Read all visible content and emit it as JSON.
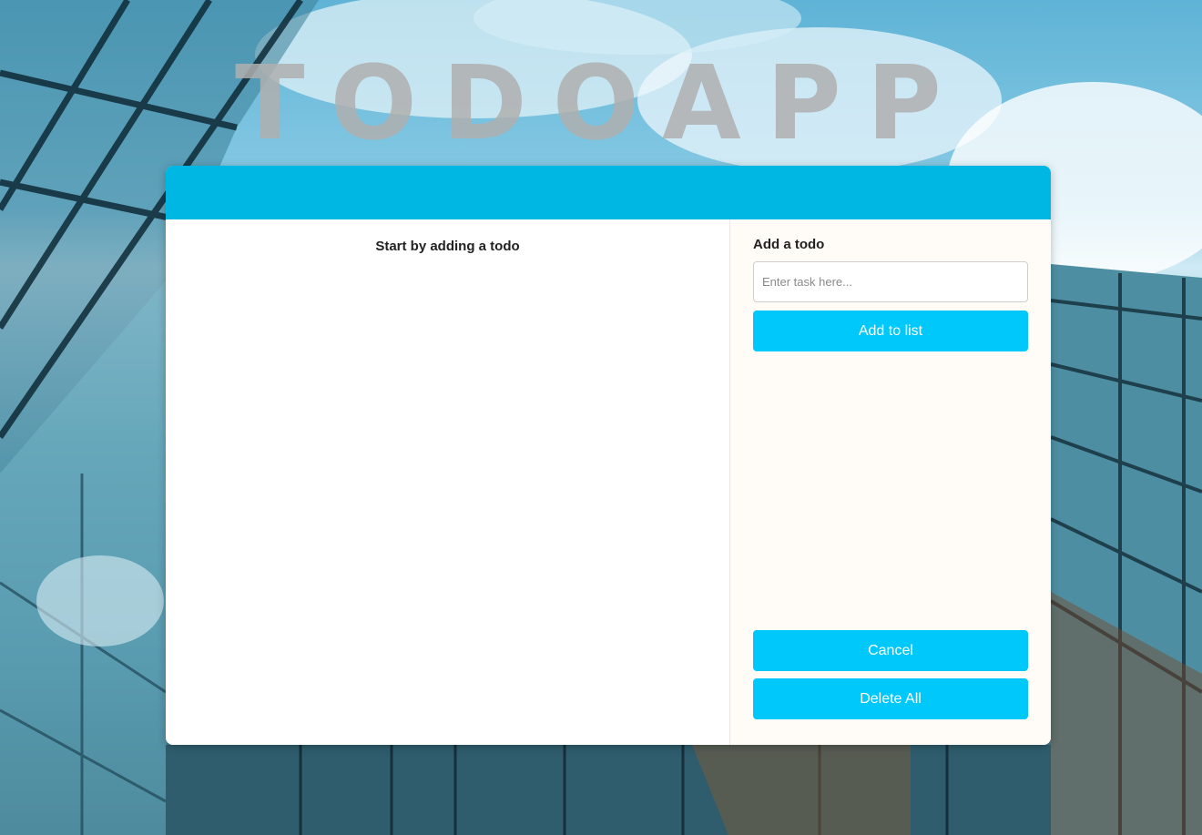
{
  "app": {
    "title": "TODOAPP"
  },
  "list": {
    "empty_message": "Start by adding a todo"
  },
  "form": {
    "label": "Add a todo",
    "input_placeholder": "Enter task here...",
    "input_value": "",
    "add_button": "Add to list",
    "cancel_button": "Cancel",
    "delete_all_button": "Delete All"
  },
  "colors": {
    "header": "#00b6e3",
    "button": "#00c8fa",
    "side_panel": "#fffbf7",
    "title": "#afafaf"
  }
}
